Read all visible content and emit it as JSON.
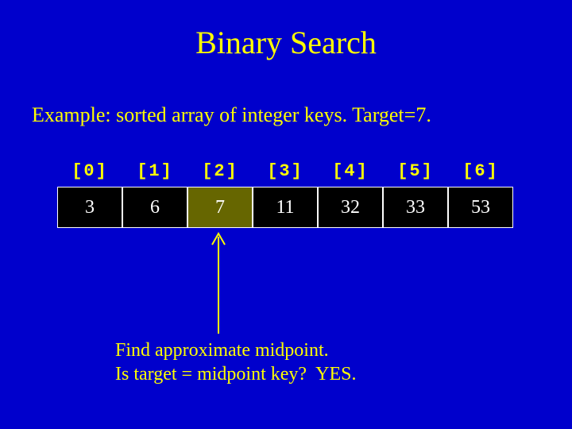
{
  "title": "Binary Search",
  "subtitle": "Example: sorted array of integer keys.  Target=7.",
  "array": {
    "indices": [
      "[0]",
      "[1]",
      "[2]",
      "[3]",
      "[4]",
      "[5]",
      "[6]"
    ],
    "values": [
      "3",
      "6",
      "7",
      "11",
      "32",
      "33",
      "53"
    ],
    "highlight_index": 2
  },
  "caption": "Find approximate midpoint.\nIs target = midpoint key?  YES.",
  "chart_data": {
    "type": "table",
    "title": "Binary Search",
    "categories": [
      0,
      1,
      2,
      3,
      4,
      5,
      6
    ],
    "values": [
      3,
      6,
      7,
      11,
      32,
      33,
      53
    ],
    "target": 7,
    "midpoint_index": 2,
    "midpoint_match": true
  }
}
